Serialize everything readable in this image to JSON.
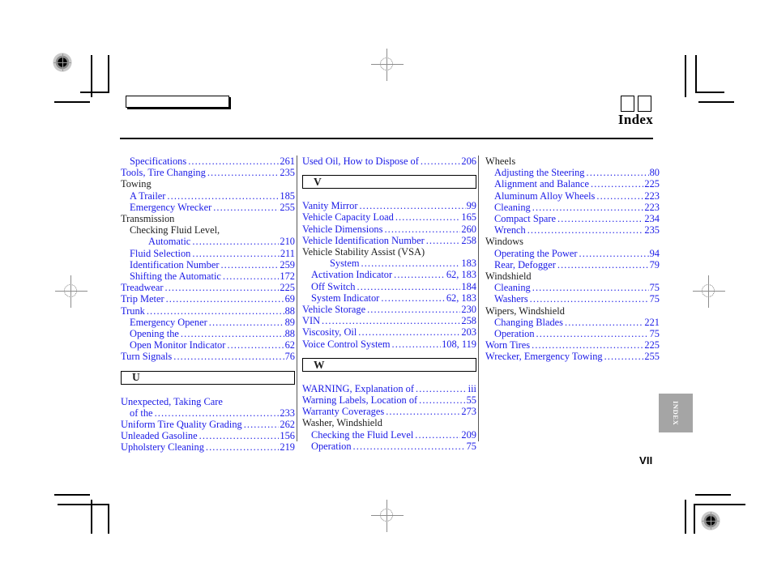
{
  "header": {
    "title": "Index",
    "empty_box_label": "",
    "small_boxes": [
      "",
      ""
    ]
  },
  "side_tab": {
    "label": "INDEX",
    "color": "#a5a5a5"
  },
  "folio": {
    "page_number": "VII"
  },
  "colors": {
    "entry_link": "#1a1ae6",
    "entry_plain": "#1d1d1d",
    "rule": "#000000",
    "tab_bg": "#a5a5a5"
  },
  "columns": [
    {
      "id": "column-1",
      "blocks": [
        {
          "type": "entries",
          "items": [
            {
              "label": "Specifications",
              "page": "261",
              "indent": 1,
              "style": "link",
              "leader": true
            },
            {
              "label": "Tools, Tire Changing",
              "page": "235",
              "indent": 0,
              "style": "link",
              "leader": true
            },
            {
              "label": "Towing",
              "page": "",
              "indent": 0,
              "style": "plain",
              "leader": false
            },
            {
              "label": "A Trailer",
              "page": "185",
              "indent": 1,
              "style": "link",
              "leader": true
            },
            {
              "label": "Emergency Wrecker",
              "page": "255",
              "indent": 1,
              "style": "link",
              "leader": true
            },
            {
              "label": "Transmission",
              "page": "",
              "indent": 0,
              "style": "plain",
              "leader": false
            },
            {
              "label": "Checking Fluid Level,",
              "page": "",
              "indent": 1,
              "style": "plain",
              "leader": false
            },
            {
              "label": "Automatic",
              "page": "210",
              "indent": 2,
              "style": "link",
              "leader": true
            },
            {
              "label": "Fluid Selection",
              "page": "211",
              "indent": 1,
              "style": "link",
              "leader": true
            },
            {
              "label": "Identification Number",
              "page": "259",
              "indent": 1,
              "style": "link",
              "leader": true
            },
            {
              "label": "Shifting the Automatic",
              "page": "172",
              "indent": 1,
              "style": "link",
              "leader": true
            },
            {
              "label": "Treadwear",
              "page": "225",
              "indent": 0,
              "style": "link",
              "leader": true
            },
            {
              "label": "Trip Meter",
              "page": "69",
              "indent": 0,
              "style": "link",
              "leader": true
            },
            {
              "label": "Trunk",
              "page": "88",
              "indent": 0,
              "style": "link",
              "leader": true
            },
            {
              "label": "Emergency Opener",
              "page": "89",
              "indent": 1,
              "style": "link",
              "leader": true
            },
            {
              "label": "Opening the",
              "page": "88",
              "indent": 1,
              "style": "link",
              "leader": true
            },
            {
              "label": "Open Monitor Indicator",
              "page": "62",
              "indent": 1,
              "style": "link",
              "leader": true
            },
            {
              "label": "Turn Signals",
              "page": "76",
              "indent": 0,
              "style": "link",
              "leader": true
            }
          ]
        },
        {
          "type": "section",
          "letter": "U"
        },
        {
          "type": "entries",
          "items": [
            {
              "label": "Unexpected, Taking Care",
              "page": "",
              "indent": 0,
              "style": "link",
              "leader": false
            },
            {
              "label": "of the",
              "page": "233",
              "indent": 1,
              "style": "link",
              "leader": true
            },
            {
              "label": "Uniform Tire Quality Grading",
              "page": "262",
              "indent": 0,
              "style": "link",
              "leader": true
            },
            {
              "label": "Unleaded Gasoline",
              "page": "156",
              "indent": 0,
              "style": "link",
              "leader": true
            },
            {
              "label": "Upholstery Cleaning",
              "page": "219",
              "indent": 0,
              "style": "link",
              "leader": true
            }
          ]
        }
      ]
    },
    {
      "id": "column-2",
      "blocks": [
        {
          "type": "entries",
          "items": [
            {
              "label": "Used Oil, How to Dispose of",
              "page": "206",
              "indent": 0,
              "style": "link",
              "leader": true
            }
          ]
        },
        {
          "type": "section",
          "letter": "V"
        },
        {
          "type": "entries",
          "items": [
            {
              "label": "Vanity Mirror",
              "page": "99",
              "indent": 0,
              "style": "link",
              "leader": true
            },
            {
              "label": "Vehicle Capacity Load",
              "page": "165",
              "indent": 0,
              "style": "link",
              "leader": true
            },
            {
              "label": "Vehicle Dimensions",
              "page": "260",
              "indent": 0,
              "style": "link",
              "leader": true
            },
            {
              "label": "Vehicle Identification Number",
              "page": "258",
              "indent": 0,
              "style": "link",
              "leader": true
            },
            {
              "label": "Vehicle Stability Assist (VSA)",
              "page": "",
              "indent": 0,
              "style": "plain",
              "leader": false
            },
            {
              "label": "System",
              "page": "183",
              "indent": 2,
              "style": "link",
              "leader": true
            },
            {
              "label": "Activation Indicator",
              "page": "62, 183",
              "indent": 1,
              "style": "link",
              "leader": true
            },
            {
              "label": "Off Switch",
              "page": "184",
              "indent": 1,
              "style": "link",
              "leader": true
            },
            {
              "label": "System Indicator",
              "page": "62, 183",
              "indent": 1,
              "style": "link",
              "leader": true
            },
            {
              "label": "Vehicle Storage",
              "page": "230",
              "indent": 0,
              "style": "link",
              "leader": true
            },
            {
              "label": "VIN",
              "page": "258",
              "indent": 0,
              "style": "link",
              "leader": true
            },
            {
              "label": "Viscosity, Oil",
              "page": "203",
              "indent": 0,
              "style": "link",
              "leader": true
            },
            {
              "label": "Voice Control System",
              "page": "108, 119",
              "indent": 0,
              "style": "link",
              "leader": true
            }
          ]
        },
        {
          "type": "section",
          "letter": "W"
        },
        {
          "type": "entries",
          "items": [
            {
              "label": "WARNING, Explanation of",
              "page": "iii",
              "indent": 0,
              "style": "link",
              "leader": true
            },
            {
              "label": "Warning Labels, Location of",
              "page": "55",
              "indent": 0,
              "style": "link",
              "leader": true
            },
            {
              "label": "Warranty Coverages",
              "page": "273",
              "indent": 0,
              "style": "link",
              "leader": true
            },
            {
              "label": "Washer, Windshield",
              "page": "",
              "indent": 0,
              "style": "plain",
              "leader": false
            },
            {
              "label": "Checking the Fluid Level",
              "page": "209",
              "indent": 1,
              "style": "link",
              "leader": true
            },
            {
              "label": "Operation",
              "page": "75",
              "indent": 1,
              "style": "link",
              "leader": true
            }
          ]
        }
      ]
    },
    {
      "id": "column-3",
      "blocks": [
        {
          "type": "entries",
          "items": [
            {
              "label": "Wheels",
              "page": "",
              "indent": 0,
              "style": "plain",
              "leader": false
            },
            {
              "label": "Adjusting the Steering",
              "page": "80",
              "indent": 1,
              "style": "link",
              "leader": true
            },
            {
              "label": "Alignment and Balance",
              "page": "225",
              "indent": 1,
              "style": "link",
              "leader": true
            },
            {
              "label": "Aluminum Alloy Wheels",
              "page": "223",
              "indent": 1,
              "style": "link",
              "leader": true
            },
            {
              "label": "Cleaning",
              "page": "223",
              "indent": 1,
              "style": "link",
              "leader": true
            },
            {
              "label": "Compact Spare",
              "page": "234",
              "indent": 1,
              "style": "link",
              "leader": true
            },
            {
              "label": "Wrench",
              "page": "235",
              "indent": 1,
              "style": "link",
              "leader": true
            },
            {
              "label": "Windows",
              "page": "",
              "indent": 0,
              "style": "plain",
              "leader": false
            },
            {
              "label": "Operating the Power",
              "page": "94",
              "indent": 1,
              "style": "link",
              "leader": true
            },
            {
              "label": "Rear, Defogger",
              "page": "79",
              "indent": 1,
              "style": "link",
              "leader": true
            },
            {
              "label": "Windshield",
              "page": "",
              "indent": 0,
              "style": "plain",
              "leader": false
            },
            {
              "label": "Cleaning",
              "page": "75",
              "indent": 1,
              "style": "link",
              "leader": true
            },
            {
              "label": "Washers",
              "page": "75",
              "indent": 1,
              "style": "link",
              "leader": true
            },
            {
              "label": "Wipers, Windshield",
              "page": "",
              "indent": 0,
              "style": "plain",
              "leader": false
            },
            {
              "label": "Changing Blades",
              "page": "221",
              "indent": 1,
              "style": "link",
              "leader": true
            },
            {
              "label": "Operation",
              "page": "75",
              "indent": 1,
              "style": "link",
              "leader": true
            },
            {
              "label": "Worn Tires",
              "page": "225",
              "indent": 0,
              "style": "link",
              "leader": true
            },
            {
              "label": "Wrecker, Emergency Towing",
              "page": "255",
              "indent": 0,
              "style": "link",
              "leader": true
            }
          ]
        }
      ]
    }
  ]
}
